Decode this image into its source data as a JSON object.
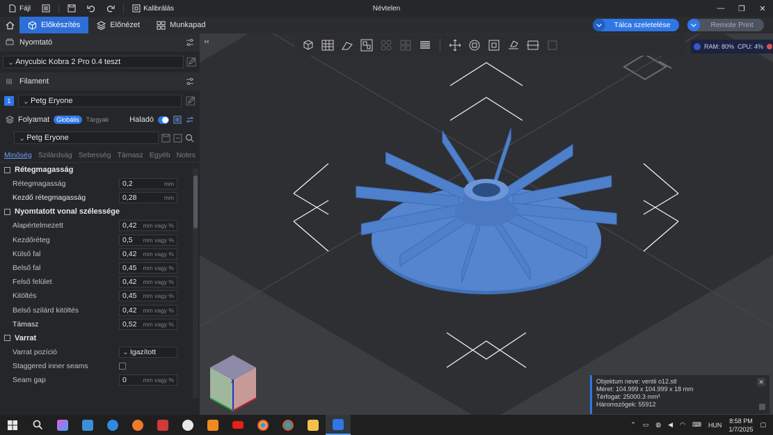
{
  "titlebar": {
    "file_label": "Fájl",
    "calibrate_label": "Kalibrálás",
    "window_title": "Névtelen"
  },
  "tabs": {
    "prepare": "Előkészítés",
    "preview": "Előnézet",
    "workbench": "Munkapad"
  },
  "actions": {
    "slice_plate": "Tálca szeletelése",
    "remote_print": "Remote Print"
  },
  "printer": {
    "section_label": "Nyomtató",
    "selected": "Anycubic Kobra 2 Pro 0.4 teszt"
  },
  "filament": {
    "section_label": "Filament",
    "slot_number": "1",
    "selected": "Petg Eryone"
  },
  "process": {
    "section_label": "Folyamat",
    "global_label": "Globális",
    "objects_label": "Tárgyak",
    "advanced_label": "Haladó",
    "preset": "Petg Eryone",
    "subtabs": [
      "Minőség",
      "Szilárdság",
      "Sebesség",
      "Támasz",
      "Egyéb",
      "Notes"
    ]
  },
  "params": {
    "layer_group": "Rétegmagasság",
    "layer_height": {
      "label": "Rétegmagasság",
      "value": "0,2",
      "unit": "mm"
    },
    "first_layer_height": {
      "label": "Kezdő rétegmagasság",
      "value": "0,28",
      "unit": "mm"
    },
    "width_group": "Nyomtatott vonal szélessége",
    "default_width": {
      "label": "Alapértelmezett",
      "value": "0,42",
      "unit": "mm vagy %"
    },
    "first_layer_width": {
      "label": "Kezdőréteg",
      "value": "0,5",
      "unit": "mm vagy %"
    },
    "outer_wall": {
      "label": "Külső fal",
      "value": "0,42",
      "unit": "mm vagy %"
    },
    "inner_wall": {
      "label": "Belső fal",
      "value": "0,45",
      "unit": "mm vagy %"
    },
    "top_surface": {
      "label": "Felső felület",
      "value": "0,42",
      "unit": "mm vagy %"
    },
    "sparse_infill": {
      "label": "Kitöltés",
      "value": "0,45",
      "unit": "mm vagy %"
    },
    "solid_infill": {
      "label": "Belső szilárd kitöltés",
      "value": "0,42",
      "unit": "mm vagy %"
    },
    "support": {
      "label": "Támasz",
      "value": "0,52",
      "unit": "mm vagy %"
    },
    "seam_group": "Varrat",
    "seam_position": {
      "label": "Varrat pozíció",
      "value": "Igazított"
    },
    "staggered": {
      "label": "Staggered inner seams"
    },
    "seam_gap": {
      "label": "Seam gap",
      "value": "0",
      "unit": "mm vagy %"
    }
  },
  "stats": {
    "ram": "RAM: 80%",
    "cpu": "CPU: 4%"
  },
  "object_info": {
    "name": "Objektum neve: ventii o12.stl",
    "size": "Méret: 104.999 x 104.999 x 18 mm",
    "volume": "Térfogat: 25000.3 mm³",
    "triangles": "Háromszögek: 55912"
  },
  "taskbar": {
    "language": "HUN",
    "time": "8:58 PM",
    "date": "1/7/2025"
  },
  "colors": {
    "accent": "#2f77e6",
    "model": "#4d7dc9",
    "bed": "#2e2f33"
  }
}
